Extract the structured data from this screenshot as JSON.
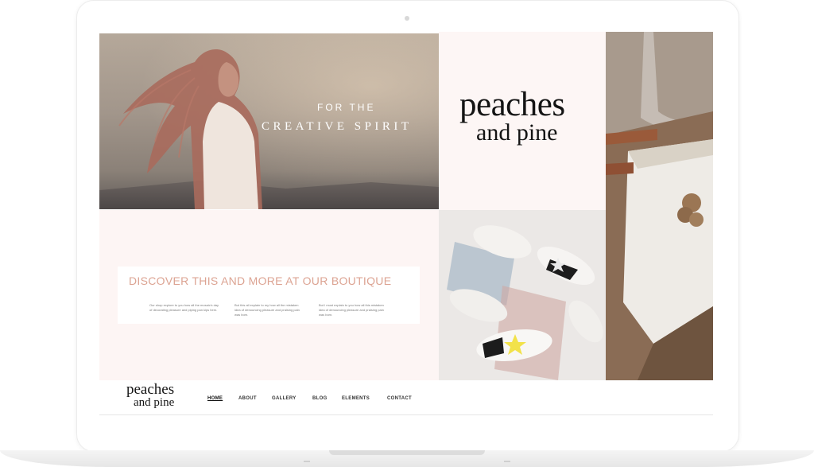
{
  "hero": {
    "line1": "FOR THE",
    "line2": "CREATIVE SPIRIT"
  },
  "logo": {
    "line1": "peaches",
    "line2": "and pine"
  },
  "discover": {
    "title": "DISCOVER THIS AND MORE AT OUR BOUTIQUE",
    "columns": [
      "Our shop explore to you how all the mosaic's day of decorating pleasure and piping pan kips hem.",
      "But this all explain to my how all the mistaken idea of denouncing pleasure and praising pain was born.",
      "But I must explain to you how all this mistaken idea of denouncing pleasure and praising pain was born."
    ]
  },
  "nav": {
    "logo_line1": "peaches",
    "logo_line2": "and pine",
    "items": [
      "HOME",
      "ABOUT",
      "GALLERY",
      "BLOG",
      "ELEMENTS",
      "CONTACT"
    ]
  },
  "colors": {
    "accent": "#dca392",
    "panel_pink": "#fdf6f5"
  },
  "icons": [
    "laptop-frame-icon",
    "camera-dot-icon"
  ]
}
